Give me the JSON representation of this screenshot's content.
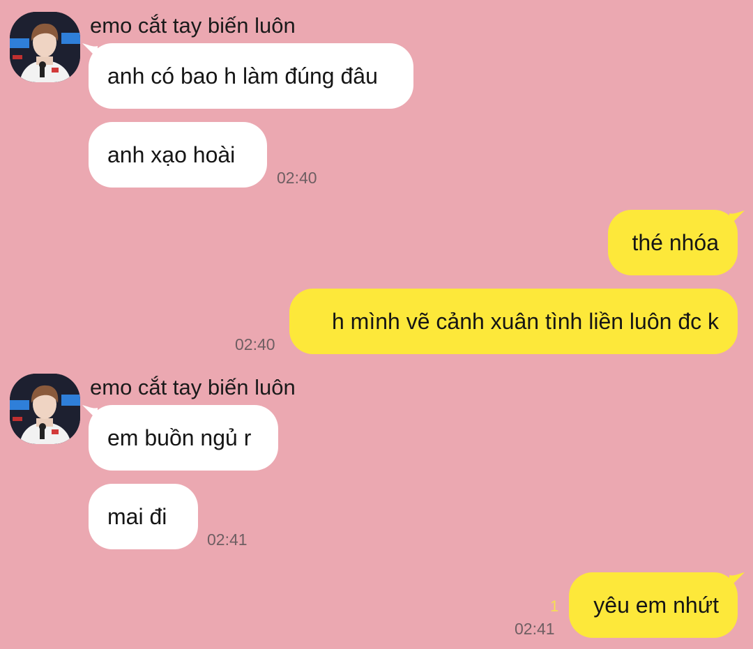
{
  "colors": {
    "background": "#eba8b1",
    "incoming_bubble": "#ffffff",
    "outgoing_bubble": "#fde83a",
    "timestamp": "#6e5e62",
    "unread_counter": "#f5e050"
  },
  "groups": [
    {
      "type": "incoming",
      "sender": "emo cắt tay biến luôn",
      "avatar_icon": "contact-avatar-photo",
      "messages": [
        "anh có bao h làm đúng đâu",
        "anh xạo hoài"
      ],
      "time": "02:40"
    },
    {
      "type": "outgoing",
      "messages": [
        "thé nhóa",
        "h mình vẽ cảnh xuân tình liền luôn đc k"
      ],
      "time": "02:40"
    },
    {
      "type": "incoming",
      "sender": "emo cắt tay biến luôn",
      "avatar_icon": "contact-avatar-photo",
      "messages": [
        "em buồn ngủ r",
        "mai đi"
      ],
      "time": "02:41"
    },
    {
      "type": "outgoing",
      "messages": [
        "yêu em nhứt"
      ],
      "unread_count": "1",
      "time": "02:41"
    }
  ]
}
